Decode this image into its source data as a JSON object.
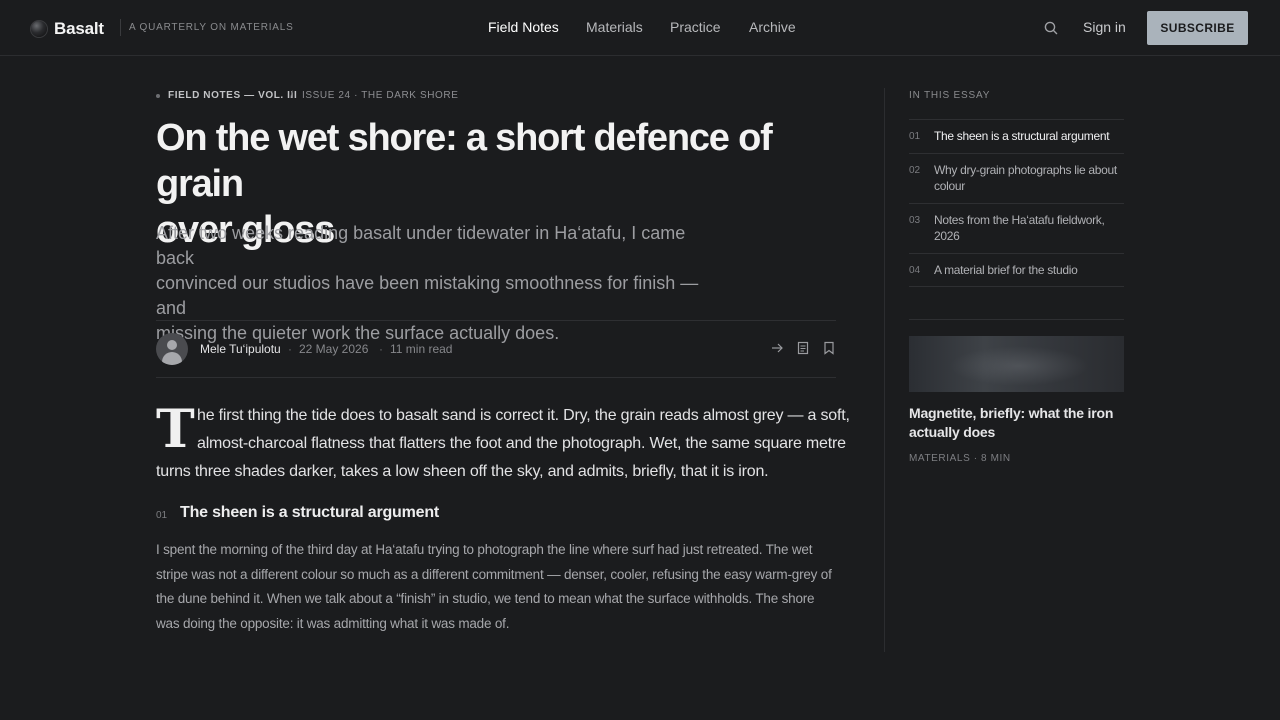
{
  "brand": {
    "name": "Basalt",
    "tagline": "A QUARTERLY ON MATERIALS"
  },
  "nav": [
    {
      "label": "Field Notes",
      "active": true
    },
    {
      "label": "Materials",
      "active": false
    },
    {
      "label": "Practice",
      "active": false
    },
    {
      "label": "Archive",
      "active": false
    }
  ],
  "header": {
    "search_icon": "search-icon",
    "signin_label": "Sign in",
    "subscribe_label": "SUBSCRIBE"
  },
  "article": {
    "crumb_section": "FIELD NOTES — VOL. III",
    "crumb_sep": "/",
    "crumb_issue": "ISSUE 24 · THE DARK SHORE",
    "title_line1": "On the wet shore: a short defence of grain",
    "title_line2": "over gloss",
    "dek_line1": "After two weeks reading basalt under tidewater in Ha‘atafu, I came back",
    "dek_line2": "convinced our studios have been mistaking smoothness for finish — and",
    "dek_line3": "missing the quieter work the surface actually does.",
    "author": "Mele Tu‘ipulotu",
    "date": "22 May 2026",
    "read_time": "11 min read",
    "meta_sep": "·",
    "actions": [
      "share-arrow-icon",
      "document-icon",
      "bookmark-icon"
    ],
    "dropcap": "T",
    "lede_line1": "he first thing the tide does to basalt sand is correct it. Dry, the grain reads almost grey — a soft,",
    "lede_line2": "almost-charcoal flatness that flatters the foot and the photograph. Wet, the same square metre",
    "lede_line3": "turns three shades darker, takes a low sheen off the sky, and admits, briefly, that it is iron.",
    "section_num": "01",
    "section_title": "The sheen is a structural argument",
    "body_line1": "I spent the morning of the third day at Ha‘atafu trying to photograph the line where surf had just retreated. The wet",
    "body_line2": "stripe was not a different colour so much as a different commitment — denser, cooler, refusing the easy warm-grey of",
    "body_line3": "the dune behind it. When we talk about a “finish” in studio, we tend to mean what the surface withholds. The shore",
    "body_line4": "was doing the opposite: it was admitting what it was made of."
  },
  "sidebar": {
    "toc_label": "IN THIS ESSAY",
    "toc": [
      {
        "num": "01",
        "text": "The sheen is a structural argument",
        "current": true
      },
      {
        "num": "02",
        "text": "Why dry-grain photographs lie about colour",
        "current": false
      },
      {
        "num": "03",
        "text": "Notes from the Ha‘atafu fieldwork, 2026",
        "current": false
      },
      {
        "num": "04",
        "text": "A material brief for the studio",
        "current": false
      }
    ],
    "card": {
      "title": "Magnetite, briefly: what the iron actually does",
      "meta": "MATERIALS · 8 MIN"
    }
  }
}
